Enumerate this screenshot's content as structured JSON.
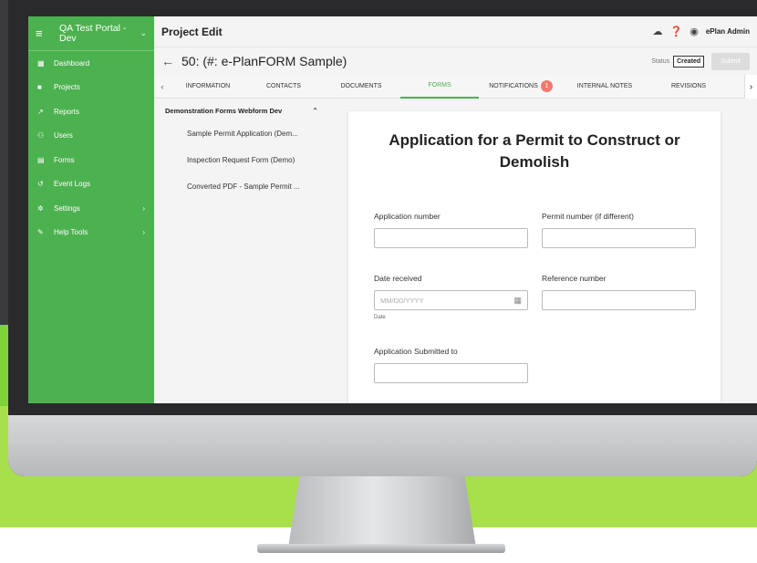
{
  "sidebar": {
    "portal_title": "QA Test Portal - Dev",
    "menu_icon": "hamburger-icon",
    "items": [
      {
        "label": "Dashboard",
        "icon": "grid-icon",
        "arrow": ""
      },
      {
        "label": "Projects",
        "icon": "folder-icon",
        "arrow": ""
      },
      {
        "label": "Reports",
        "icon": "trend-icon",
        "arrow": ""
      },
      {
        "label": "Users",
        "icon": "users-icon",
        "arrow": ""
      },
      {
        "label": "Forms",
        "icon": "document-icon",
        "arrow": ""
      },
      {
        "label": "Event Logs",
        "icon": "history-icon",
        "arrow": ""
      },
      {
        "label": "Settings",
        "icon": "gear-icon",
        "arrow": "›"
      },
      {
        "label": "Help Tools",
        "icon": "wrench-icon",
        "arrow": "›"
      }
    ]
  },
  "header": {
    "page_title": "Project Edit",
    "user_name": "ePlan Admin",
    "project_title": "50: (#: e-PlanFORM Sample)",
    "status_label": "Status",
    "status_value": "Created",
    "submit_label": "Submit"
  },
  "tabs": [
    {
      "label": "INFORMATION",
      "active": false
    },
    {
      "label": "CONTACTS",
      "active": false
    },
    {
      "label": "DOCUMENTS",
      "active": false
    },
    {
      "label": "FORMS",
      "active": true
    },
    {
      "label": "NOTIFICATIONS",
      "active": false,
      "count": "1"
    },
    {
      "label": "INTERNAL NOTES",
      "active": false
    },
    {
      "label": "REVISIONS",
      "active": false
    }
  ],
  "form_list": {
    "group_label": "Demonstration Forms Webform Dev",
    "items": [
      "Sample Permit Application (Dem...",
      "Inspection Request Form (Demo)",
      "Converted PDF - Sample Permit ..."
    ]
  },
  "form": {
    "title": "Application for a Permit to Construct or Demolish",
    "fields": {
      "application_number": {
        "label": "Application number",
        "value": ""
      },
      "permit_number": {
        "label": "Permit number (if different)",
        "value": ""
      },
      "date_received": {
        "label": "Date received",
        "placeholder": "MM/DD/YYYY",
        "hint": "Date"
      },
      "reference_number": {
        "label": "Reference number",
        "value": ""
      },
      "submitted_to": {
        "label": "Application Submitted to",
        "value": ""
      }
    }
  },
  "colors": {
    "sidebar_green": "#4cb14f",
    "active_tab": "#4cb14f",
    "notification_badge": "#f07a6f"
  }
}
